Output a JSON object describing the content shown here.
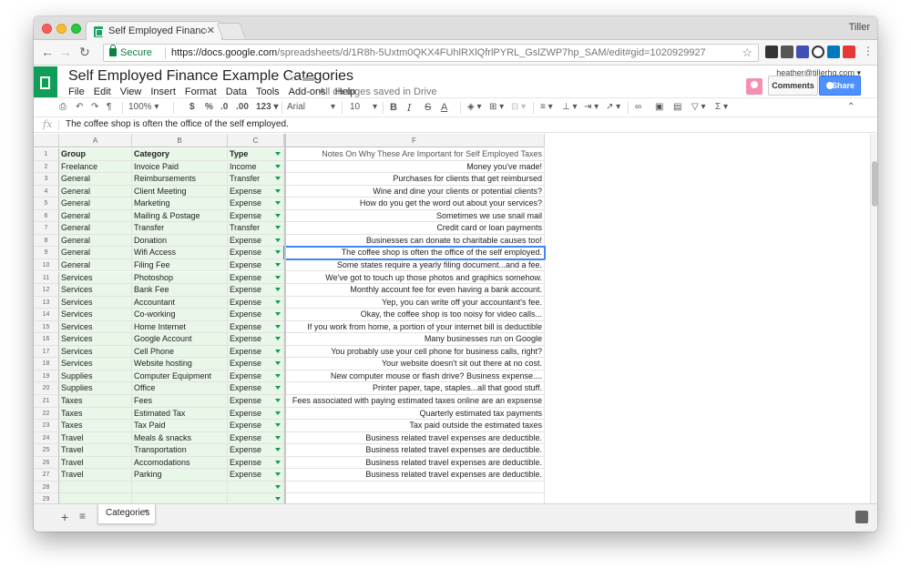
{
  "browser": {
    "tab_title": "Self Employed Finance Example",
    "profile_name": "Tiller",
    "secure_label": "Secure",
    "url_host": "https://docs.google.com",
    "url_path": "/spreadsheets/d/1R8h-5Uxtm0QKX4FUhlRXlQfrlPYRL_GslZWP7hp_SAM/edit#gid=1020929927"
  },
  "sheet": {
    "doc_title": "Self Employed Finance Example Categories",
    "menu": [
      "File",
      "Edit",
      "View",
      "Insert",
      "Format",
      "Data",
      "Tools",
      "Add-ons",
      "Help"
    ],
    "save_status": "All changes saved in Drive",
    "account": "heather@tillerhq.com",
    "comments_label": "Comments",
    "share_label": "Share"
  },
  "toolbar": {
    "zoom": "100%",
    "currency": "$",
    "percent": "%",
    "dec_less": ".0",
    "dec_more": ".00",
    "format_more": "123",
    "font": "Arial",
    "font_size": "10",
    "bold": "B",
    "italic": "I",
    "strike": "S",
    "text_color": "A",
    "sum": "Σ"
  },
  "formula_bar": {
    "fx": "fx",
    "value": "The coffee shop is often the office of the self employed."
  },
  "grid": {
    "columns": [
      "A",
      "B",
      "C",
      "F"
    ],
    "header": {
      "row": "1",
      "A": "Group",
      "B": "Category",
      "C": "Type",
      "F": "Notes On Why These Are Important for Self Employed Taxes"
    },
    "rows": [
      {
        "n": "2",
        "A": "Freelance",
        "B": "Invoice Paid",
        "C": "Income",
        "F": "Money you've made!"
      },
      {
        "n": "3",
        "A": "General",
        "B": "Reimbursements",
        "C": "Transfer",
        "F": "Purchases for clients that get reimbursed"
      },
      {
        "n": "4",
        "A": "General",
        "B": "Client Meeting",
        "C": "Expense",
        "F": "Wine and dine your clients or potential clients?"
      },
      {
        "n": "5",
        "A": "General",
        "B": "Marketing",
        "C": "Expense",
        "F": "How do you get the word out about your services?"
      },
      {
        "n": "6",
        "A": "General",
        "B": "Mailing & Postage",
        "C": "Expense",
        "F": "Sometimes we use snail mail"
      },
      {
        "n": "7",
        "A": "General",
        "B": "Transfer",
        "C": "Transfer",
        "F": "Credit card or loan payments"
      },
      {
        "n": "8",
        "A": "General",
        "B": "Donation",
        "C": "Expense",
        "F": "Businesses can donate to charitable causes too!"
      },
      {
        "n": "9",
        "A": "General",
        "B": "Wifi Access",
        "C": "Expense",
        "F": "The coffee shop is often the office of the self employed."
      },
      {
        "n": "10",
        "A": "General",
        "B": "Filing Fee",
        "C": "Expense",
        "F": "Some states require a yearly filing document...and a fee."
      },
      {
        "n": "11",
        "A": "Services",
        "B": "Photoshop",
        "C": "Expense",
        "F": "We've got to touch up those photos and graphics somehow."
      },
      {
        "n": "12",
        "A": "Services",
        "B": "Bank Fee",
        "C": "Expense",
        "F": "Monthly account fee for even having a bank account."
      },
      {
        "n": "13",
        "A": "Services",
        "B": "Accountant",
        "C": "Expense",
        "F": "Yep, you can write off your accountant's fee."
      },
      {
        "n": "14",
        "A": "Services",
        "B": "Co-working",
        "C": "Expense",
        "F": "Okay, the coffee shop is too noisy for video calls..."
      },
      {
        "n": "15",
        "A": "Services",
        "B": "Home Internet",
        "C": "Expense",
        "F": "If you work from home, a portion of your internet bill is deductible"
      },
      {
        "n": "16",
        "A": "Services",
        "B": "Google Account",
        "C": "Expense",
        "F": "Many businesses run on Google"
      },
      {
        "n": "17",
        "A": "Services",
        "B": "Cell Phone",
        "C": "Expense",
        "F": "You probably use your cell phone for business calls, right?"
      },
      {
        "n": "18",
        "A": "Services",
        "B": "Website hosting",
        "C": "Expense",
        "F": "Your website doesn't sit out there at no cost."
      },
      {
        "n": "19",
        "A": "Supplies",
        "B": "Computer Equipment",
        "C": "Expense",
        "F": "New computer mouse or flash drive? Business expense...."
      },
      {
        "n": "20",
        "A": "Supplies",
        "B": "Office",
        "C": "Expense",
        "F": "Printer paper, tape, staples...all that good stuff."
      },
      {
        "n": "21",
        "A": "Taxes",
        "B": "Fees",
        "C": "Expense",
        "F": "Fees associated with paying estimated taxes online are an expsense"
      },
      {
        "n": "22",
        "A": "Taxes",
        "B": "Estimated Tax",
        "C": "Expense",
        "F": "Quarterly estimated tax payments"
      },
      {
        "n": "23",
        "A": "Taxes",
        "B": "Tax Paid",
        "C": "Expense",
        "F": "Tax paid outside the estimated taxes"
      },
      {
        "n": "24",
        "A": "Travel",
        "B": "Meals & snacks",
        "C": "Expense",
        "F": "Business related travel expenses are deductible."
      },
      {
        "n": "25",
        "A": "Travel",
        "B": "Transportation",
        "C": "Expense",
        "F": "Business related travel expenses are deductible."
      },
      {
        "n": "26",
        "A": "Travel",
        "B": "Accomodations",
        "C": "Expense",
        "F": "Business related travel expenses are deductible."
      },
      {
        "n": "27",
        "A": "Travel",
        "B": "Parking",
        "C": "Expense",
        "F": "Business related travel expenses are deductible."
      },
      {
        "n": "28",
        "A": "",
        "B": "",
        "C": "",
        "F": ""
      },
      {
        "n": "29",
        "A": "",
        "B": "",
        "C": "",
        "F": ""
      }
    ],
    "selected_row": "9"
  },
  "sheet_tabs": {
    "active": "Categories"
  }
}
